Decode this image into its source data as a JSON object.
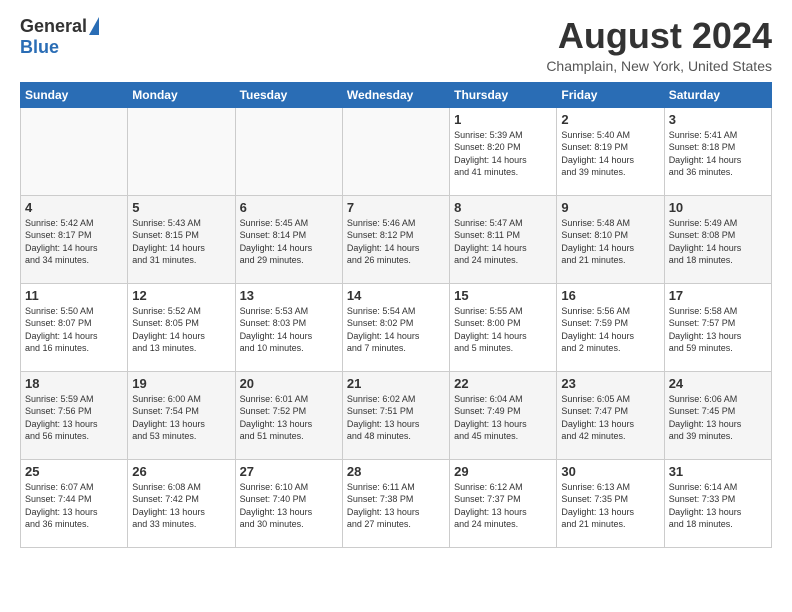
{
  "header": {
    "logo_general": "General",
    "logo_blue": "Blue",
    "month_title": "August 2024",
    "location": "Champlain, New York, United States"
  },
  "days_of_week": [
    "Sunday",
    "Monday",
    "Tuesday",
    "Wednesday",
    "Thursday",
    "Friday",
    "Saturday"
  ],
  "weeks": [
    [
      {
        "day": "",
        "info": ""
      },
      {
        "day": "",
        "info": ""
      },
      {
        "day": "",
        "info": ""
      },
      {
        "day": "",
        "info": ""
      },
      {
        "day": "1",
        "info": "Sunrise: 5:39 AM\nSunset: 8:20 PM\nDaylight: 14 hours\nand 41 minutes."
      },
      {
        "day": "2",
        "info": "Sunrise: 5:40 AM\nSunset: 8:19 PM\nDaylight: 14 hours\nand 39 minutes."
      },
      {
        "day": "3",
        "info": "Sunrise: 5:41 AM\nSunset: 8:18 PM\nDaylight: 14 hours\nand 36 minutes."
      }
    ],
    [
      {
        "day": "4",
        "info": "Sunrise: 5:42 AM\nSunset: 8:17 PM\nDaylight: 14 hours\nand 34 minutes."
      },
      {
        "day": "5",
        "info": "Sunrise: 5:43 AM\nSunset: 8:15 PM\nDaylight: 14 hours\nand 31 minutes."
      },
      {
        "day": "6",
        "info": "Sunrise: 5:45 AM\nSunset: 8:14 PM\nDaylight: 14 hours\nand 29 minutes."
      },
      {
        "day": "7",
        "info": "Sunrise: 5:46 AM\nSunset: 8:12 PM\nDaylight: 14 hours\nand 26 minutes."
      },
      {
        "day": "8",
        "info": "Sunrise: 5:47 AM\nSunset: 8:11 PM\nDaylight: 14 hours\nand 24 minutes."
      },
      {
        "day": "9",
        "info": "Sunrise: 5:48 AM\nSunset: 8:10 PM\nDaylight: 14 hours\nand 21 minutes."
      },
      {
        "day": "10",
        "info": "Sunrise: 5:49 AM\nSunset: 8:08 PM\nDaylight: 14 hours\nand 18 minutes."
      }
    ],
    [
      {
        "day": "11",
        "info": "Sunrise: 5:50 AM\nSunset: 8:07 PM\nDaylight: 14 hours\nand 16 minutes."
      },
      {
        "day": "12",
        "info": "Sunrise: 5:52 AM\nSunset: 8:05 PM\nDaylight: 14 hours\nand 13 minutes."
      },
      {
        "day": "13",
        "info": "Sunrise: 5:53 AM\nSunset: 8:03 PM\nDaylight: 14 hours\nand 10 minutes."
      },
      {
        "day": "14",
        "info": "Sunrise: 5:54 AM\nSunset: 8:02 PM\nDaylight: 14 hours\nand 7 minutes."
      },
      {
        "day": "15",
        "info": "Sunrise: 5:55 AM\nSunset: 8:00 PM\nDaylight: 14 hours\nand 5 minutes."
      },
      {
        "day": "16",
        "info": "Sunrise: 5:56 AM\nSunset: 7:59 PM\nDaylight: 14 hours\nand 2 minutes."
      },
      {
        "day": "17",
        "info": "Sunrise: 5:58 AM\nSunset: 7:57 PM\nDaylight: 13 hours\nand 59 minutes."
      }
    ],
    [
      {
        "day": "18",
        "info": "Sunrise: 5:59 AM\nSunset: 7:56 PM\nDaylight: 13 hours\nand 56 minutes."
      },
      {
        "day": "19",
        "info": "Sunrise: 6:00 AM\nSunset: 7:54 PM\nDaylight: 13 hours\nand 53 minutes."
      },
      {
        "day": "20",
        "info": "Sunrise: 6:01 AM\nSunset: 7:52 PM\nDaylight: 13 hours\nand 51 minutes."
      },
      {
        "day": "21",
        "info": "Sunrise: 6:02 AM\nSunset: 7:51 PM\nDaylight: 13 hours\nand 48 minutes."
      },
      {
        "day": "22",
        "info": "Sunrise: 6:04 AM\nSunset: 7:49 PM\nDaylight: 13 hours\nand 45 minutes."
      },
      {
        "day": "23",
        "info": "Sunrise: 6:05 AM\nSunset: 7:47 PM\nDaylight: 13 hours\nand 42 minutes."
      },
      {
        "day": "24",
        "info": "Sunrise: 6:06 AM\nSunset: 7:45 PM\nDaylight: 13 hours\nand 39 minutes."
      }
    ],
    [
      {
        "day": "25",
        "info": "Sunrise: 6:07 AM\nSunset: 7:44 PM\nDaylight: 13 hours\nand 36 minutes."
      },
      {
        "day": "26",
        "info": "Sunrise: 6:08 AM\nSunset: 7:42 PM\nDaylight: 13 hours\nand 33 minutes."
      },
      {
        "day": "27",
        "info": "Sunrise: 6:10 AM\nSunset: 7:40 PM\nDaylight: 13 hours\nand 30 minutes."
      },
      {
        "day": "28",
        "info": "Sunrise: 6:11 AM\nSunset: 7:38 PM\nDaylight: 13 hours\nand 27 minutes."
      },
      {
        "day": "29",
        "info": "Sunrise: 6:12 AM\nSunset: 7:37 PM\nDaylight: 13 hours\nand 24 minutes."
      },
      {
        "day": "30",
        "info": "Sunrise: 6:13 AM\nSunset: 7:35 PM\nDaylight: 13 hours\nand 21 minutes."
      },
      {
        "day": "31",
        "info": "Sunrise: 6:14 AM\nSunset: 7:33 PM\nDaylight: 13 hours\nand 18 minutes."
      }
    ]
  ]
}
